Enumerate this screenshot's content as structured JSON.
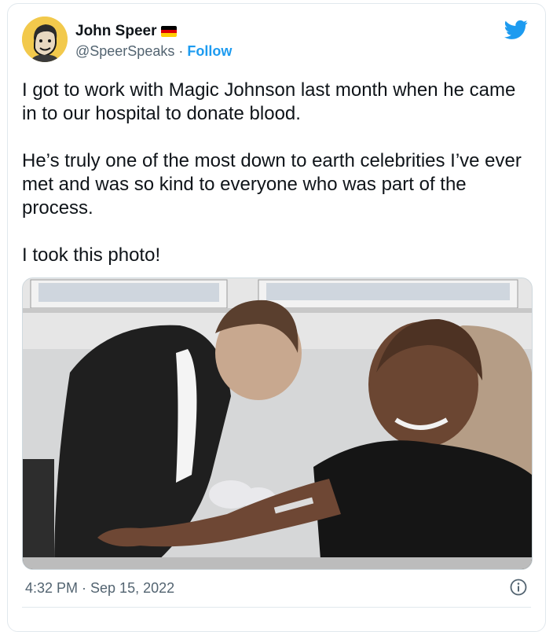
{
  "tweet": {
    "author": {
      "display_name": "John Speer",
      "flag_icon": "germany-flag-icon",
      "handle": "@SpeerSpeaks",
      "separator": "·",
      "follow_label": "Follow"
    },
    "paragraphs": [
      "I got to work with Magic Johnson last month when he came in to our hospital to donate blood.",
      "He’s truly one of the most down to earth celebrities I’ve ever met and was so kind to everyone who was part of the process.",
      "I took this photo!"
    ],
    "timestamp": "4:32 PM · Sep 15, 2022",
    "icons": {
      "brand": "twitter-bird-icon",
      "info": "info-icon"
    },
    "colors": {
      "accent": "#1d9bf0",
      "text": "#0f1419",
      "secondary": "#536471"
    }
  }
}
